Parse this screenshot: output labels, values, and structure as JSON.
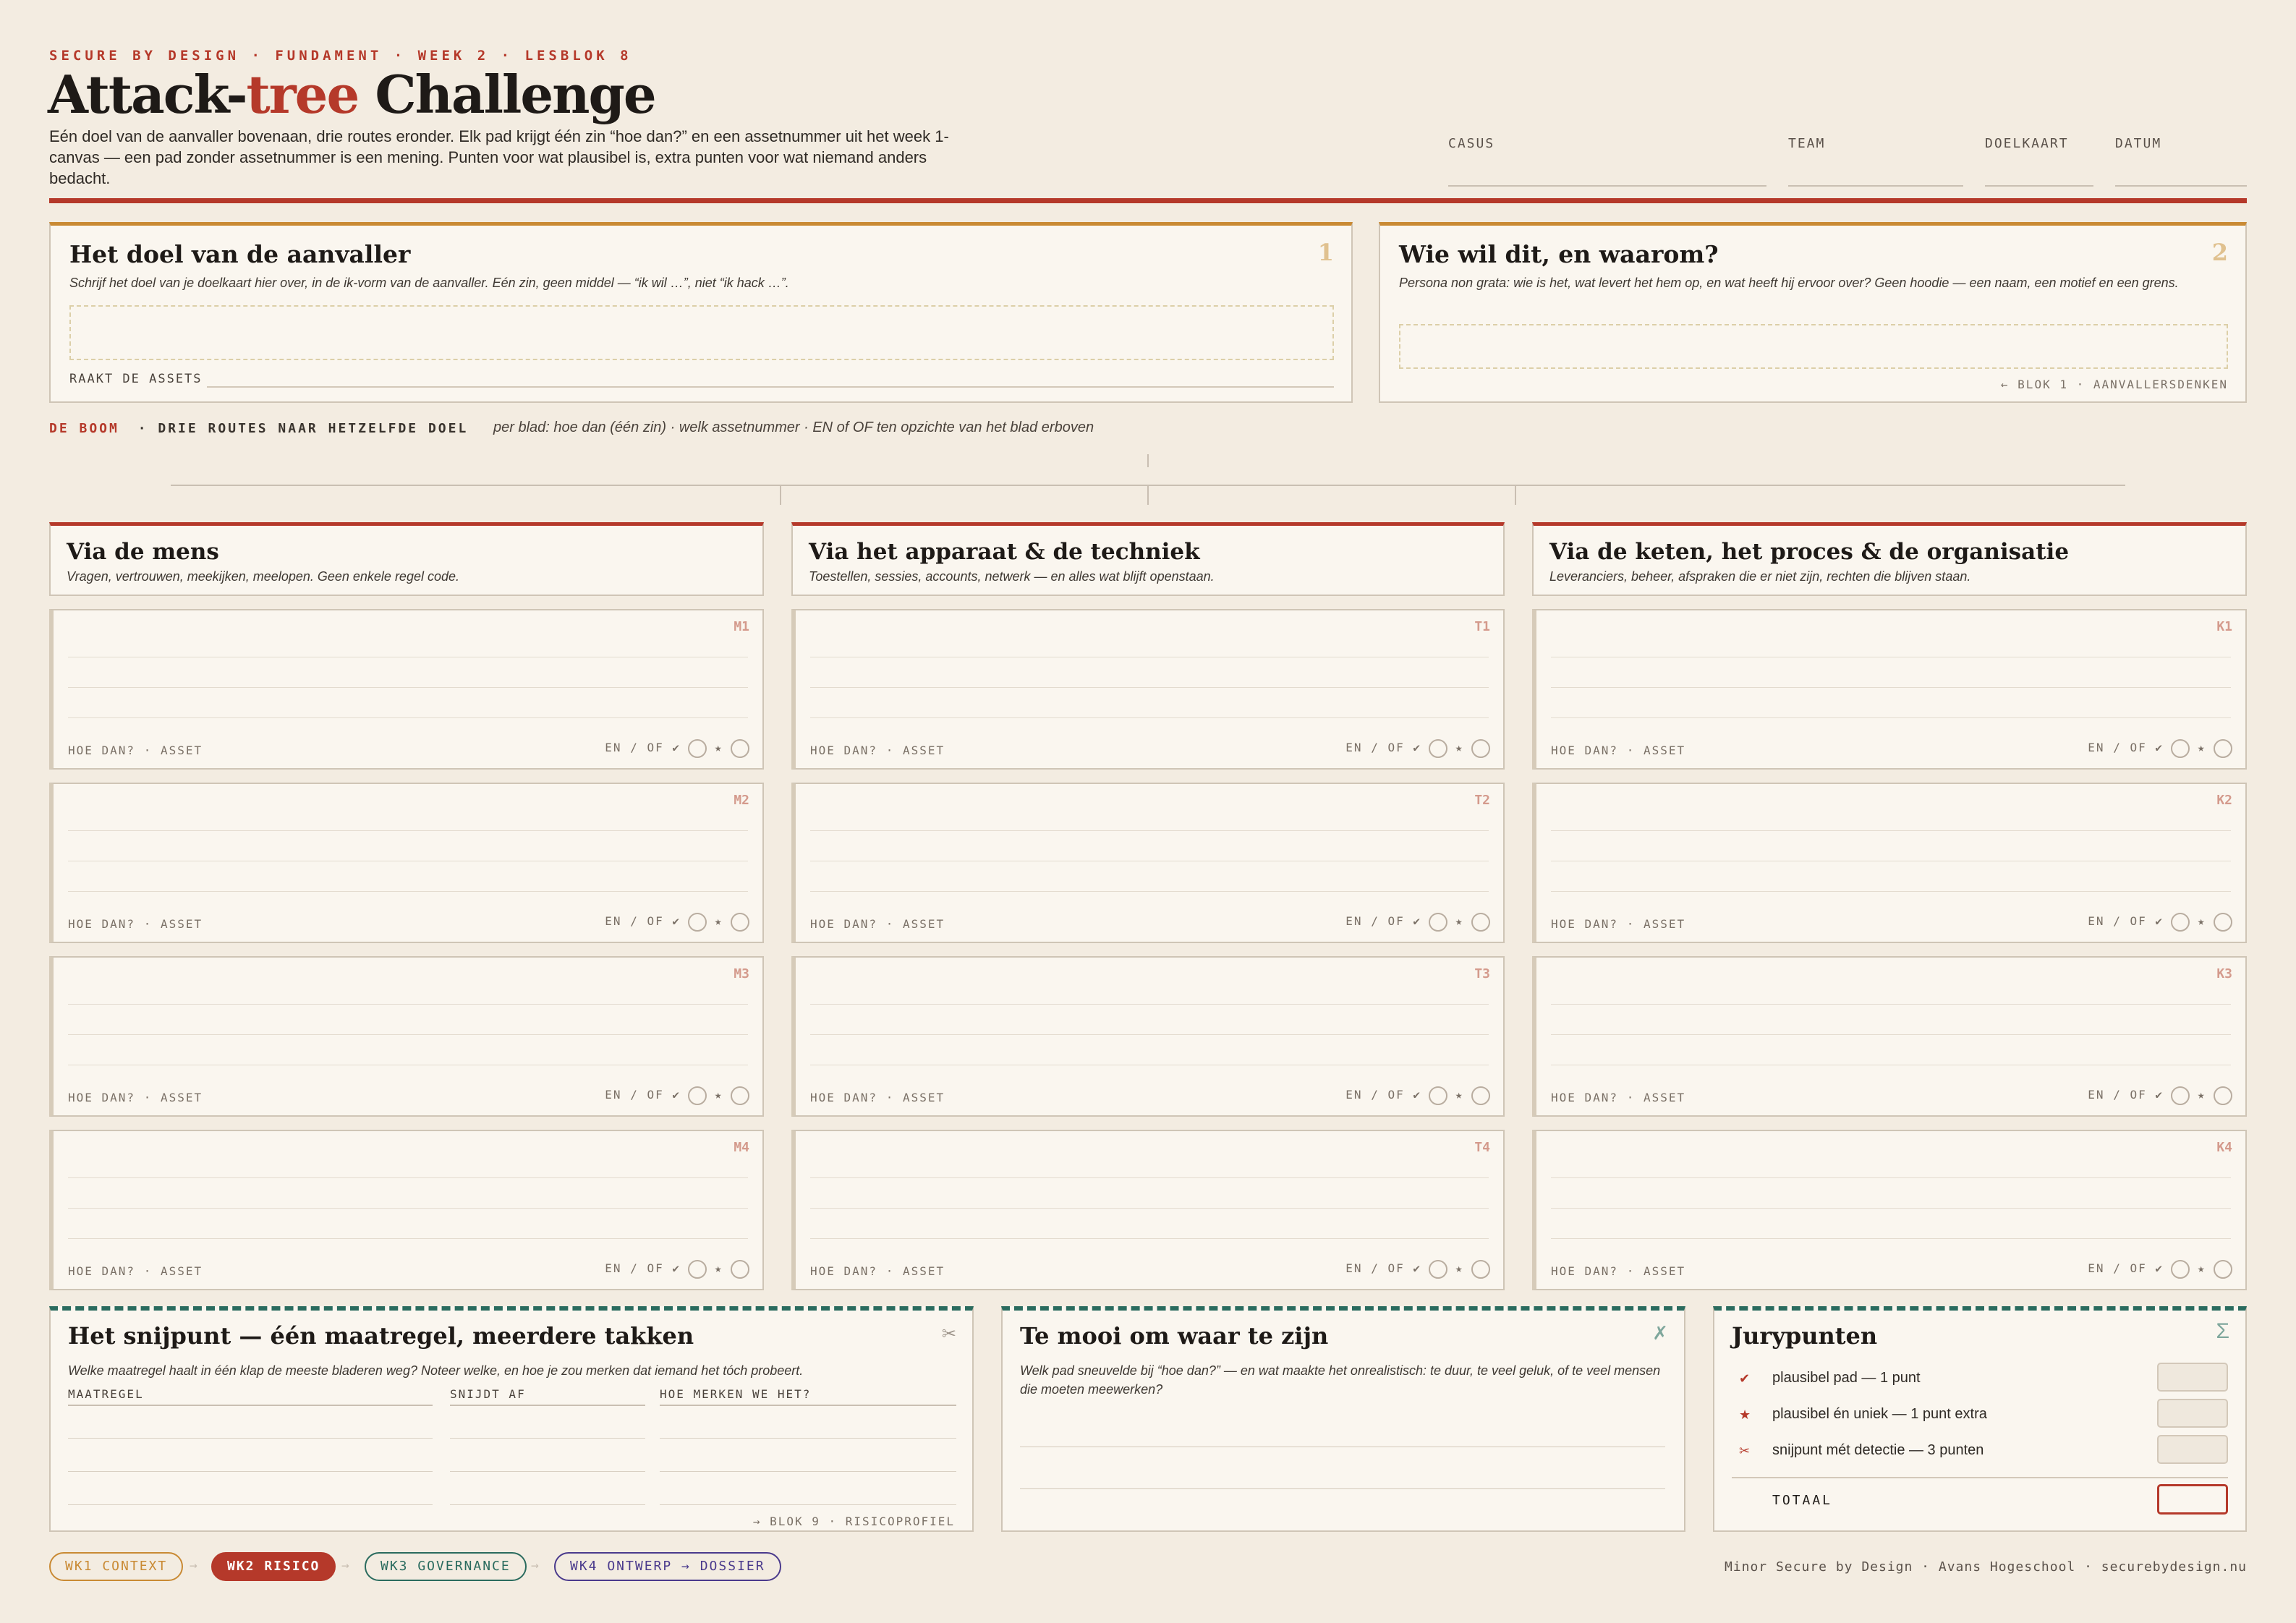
{
  "header": {
    "eyebrow": "SECURE BY DESIGN · FUNDAMENT · WEEK 2 · LESBLOK 8",
    "title_before": "Attack-",
    "title_accent": "tree",
    "title_after": " Challenge",
    "intro": "Eén doel van de aanvaller bovenaan, drie routes eronder. Elk pad krijgt één zin “hoe dan?” en een assetnummer uit het week 1-canvas — een pad zonder assetnummer is een mening. Punten voor wat plausibel is, extra punten voor wat niemand anders bedacht.",
    "fields": [
      "CASUS",
      "TEAM",
      "DOELKAART",
      "DATUM"
    ]
  },
  "goal_card": {
    "title": "Het doel van de aanvaller",
    "number": "1",
    "subtitle": "Schrijf het doel van je doelkaart hier over, in de ik-vorm van de aanvaller. Eén zin, geen middel — “ik wil …”, niet “ik hack …”.",
    "assets_label": "RAAKT DE ASSETS"
  },
  "who_card": {
    "title": "Wie wil dit, en waarom?",
    "number": "2",
    "subtitle": "Persona non grata: wie is het, wat levert het hem op, en wat heeft hij ervoor over? Geen hoodie — een naam, een motief en een grens.",
    "footer": "← BLOK 1 · AANVALLERSDENKEN"
  },
  "tree": {
    "label": "DE BOOM",
    "label_suffix": "· DRIE ROUTES NAAR HETZELFDE DOEL",
    "hint": "per blad: hoe dan (één zin) · welk assetnummer · EN of OF ten opzichte van het blad erboven",
    "leaf_footer_left": "HOE DAN? · ASSET",
    "leaf_footer_right": "EN / OF ✔",
    "star": "★",
    "columns": [
      {
        "title": "Via de mens",
        "subtitle": "Vragen, vertrouwen, meekijken, meelopen. Geen enkele regel code.",
        "leaves": [
          "M1",
          "M2",
          "M3",
          "M4"
        ]
      },
      {
        "title": "Via het apparaat & de techniek",
        "subtitle": "Toestellen, sessies, accounts, netwerk — en alles wat blijft openstaan.",
        "leaves": [
          "T1",
          "T2",
          "T3",
          "T4"
        ]
      },
      {
        "title": "Via de keten, het proces & de organisatie",
        "subtitle": "Leveranciers, beheer, afspraken die er niet zijn, rechten die blijven staan.",
        "leaves": [
          "K1",
          "K2",
          "K3",
          "K4"
        ]
      }
    ]
  },
  "snijpunt": {
    "title": "Het snijpunt — één maatregel, meerdere takken",
    "icon": "✂",
    "subtitle": "Welke maatregel haalt in één klap de meeste bladeren weg? Noteer welke, en hoe je zou merken dat iemand het tóch probeert.",
    "col1": "MAATREGEL",
    "col2": "SNIJDT AF",
    "col3": "HOE MERKEN WE HET?",
    "footer": "→ BLOK 9 · RISICOPROFIEL"
  },
  "te_mooi": {
    "title": "Te mooi om waar te zijn",
    "icon": "✗",
    "subtitle": "Welk pad sneuvelde bij “hoe dan?” — en wat maakte het onrealistisch: te duur, te veel geluk, of te veel mensen die moeten meewerken?"
  },
  "jury": {
    "title": "Jurypunten",
    "icon": "Σ",
    "rows": [
      {
        "symbol": "✔",
        "label": "plausibel pad — 1 punt"
      },
      {
        "symbol": "★",
        "label": "plausibel én uniek — 1 punt extra"
      },
      {
        "symbol": "✂",
        "label": "snijpunt mét detectie — 3 punten"
      }
    ],
    "total": "TOTAAL"
  },
  "footer": {
    "pills": [
      "WK1 CONTEXT",
      "WK2 RISICO",
      "WK3 GOVERNANCE",
      "WK4 ONTWERP → DOSSIER"
    ],
    "arrow": "→",
    "credit": "Minor Secure by Design · Avans Hogeschool · securebydesign.nu"
  },
  "colors": {
    "accent": "#b5392a",
    "gold": "#c98a34",
    "teal": "#2a6b5e",
    "purple": "#4a3a8c"
  }
}
